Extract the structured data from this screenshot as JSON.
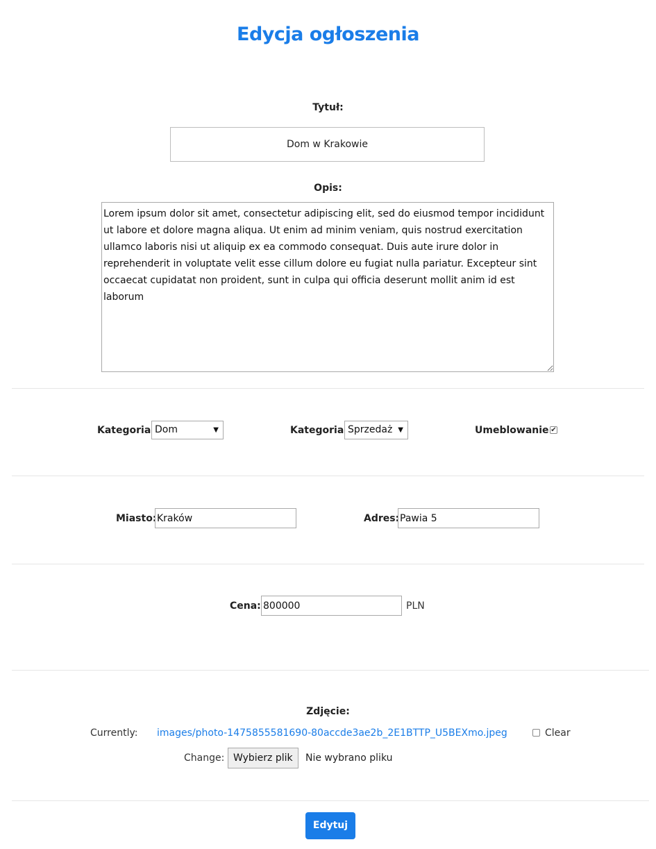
{
  "page": {
    "title": "Edycja ogłoszenia"
  },
  "form": {
    "title_label": "Tytuł:",
    "title_value": "Dom w Krakowie",
    "description_label": "Opis:",
    "description_value": "Lorem ipsum dolor sit amet, consectetur adipiscing elit, sed do eiusmod tempor incididunt ut labore et dolore magna aliqua. Ut enim ad minim veniam, quis nostrud exercitation ullamco laboris nisi ut aliquip ex ea commodo consequat. Duis aute irure dolor in reprehenderit in voluptate velit esse cillum dolore eu fugiat nulla pariatur. Excepteur sint occaecat cupidatat non proident, sunt in culpa qui officia deserunt mollit anim id est laborum",
    "category_label": "Kategoria:",
    "category_value": "Dom",
    "type_label": "Kategoria:",
    "type_value": "Sprzedaż",
    "furnished_label": "Umeblowanie:",
    "furnished_checked": true,
    "city_label": "Miasto:",
    "city_value": "Kraków",
    "address_label": "Adres:",
    "address_value": "Pawia 5",
    "price_label": "Cena:",
    "price_value": "800000",
    "price_unit": "PLN",
    "photo_label": "Zdjęcie:",
    "currently_label": "Currently:",
    "current_file": "images/photo-1475855581690-80accde3ae2b_2E1BTTP_U5BEXmo.jpeg",
    "clear_label": "Clear",
    "change_label": "Change:",
    "choose_file_label": "Wybierz plik",
    "no_file_label": "Nie wybrano pliku",
    "submit_label": "Edytuj"
  },
  "icons": {
    "dropdown": "triangle-down-icon",
    "check": "checkmark-icon"
  },
  "colors": {
    "accent": "#1a7de8",
    "divider": "#e6e6e6"
  }
}
